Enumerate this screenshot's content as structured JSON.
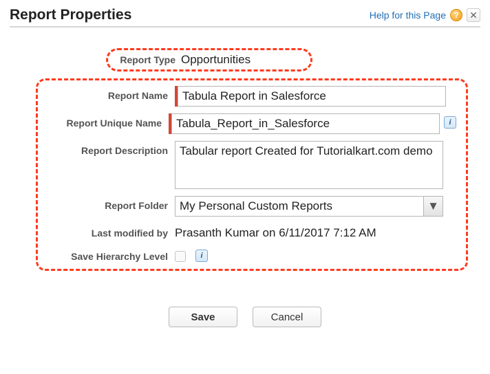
{
  "titlebar": {
    "title": "Report Properties",
    "help_label": "Help for this Page"
  },
  "report_type": {
    "label": "Report Type",
    "value": "Opportunities"
  },
  "fields": {
    "name": {
      "label": "Report Name",
      "value": "Tabula Report in Salesforce"
    },
    "unique": {
      "label": "Report Unique Name",
      "value": "Tabula_Report_in_Salesforce"
    },
    "desc": {
      "label": "Report Description",
      "value": "Tabular report Created for Tutorialkart.com demo"
    },
    "folder": {
      "label": "Report Folder",
      "selected": "My Personal Custom Reports"
    },
    "modified": {
      "label": "Last modified by",
      "value": "Prasanth Kumar on 6/11/2017 7:12 AM"
    },
    "hierarchy": {
      "label": "Save Hierarchy Level"
    }
  },
  "buttons": {
    "save": "Save",
    "cancel": "Cancel"
  }
}
